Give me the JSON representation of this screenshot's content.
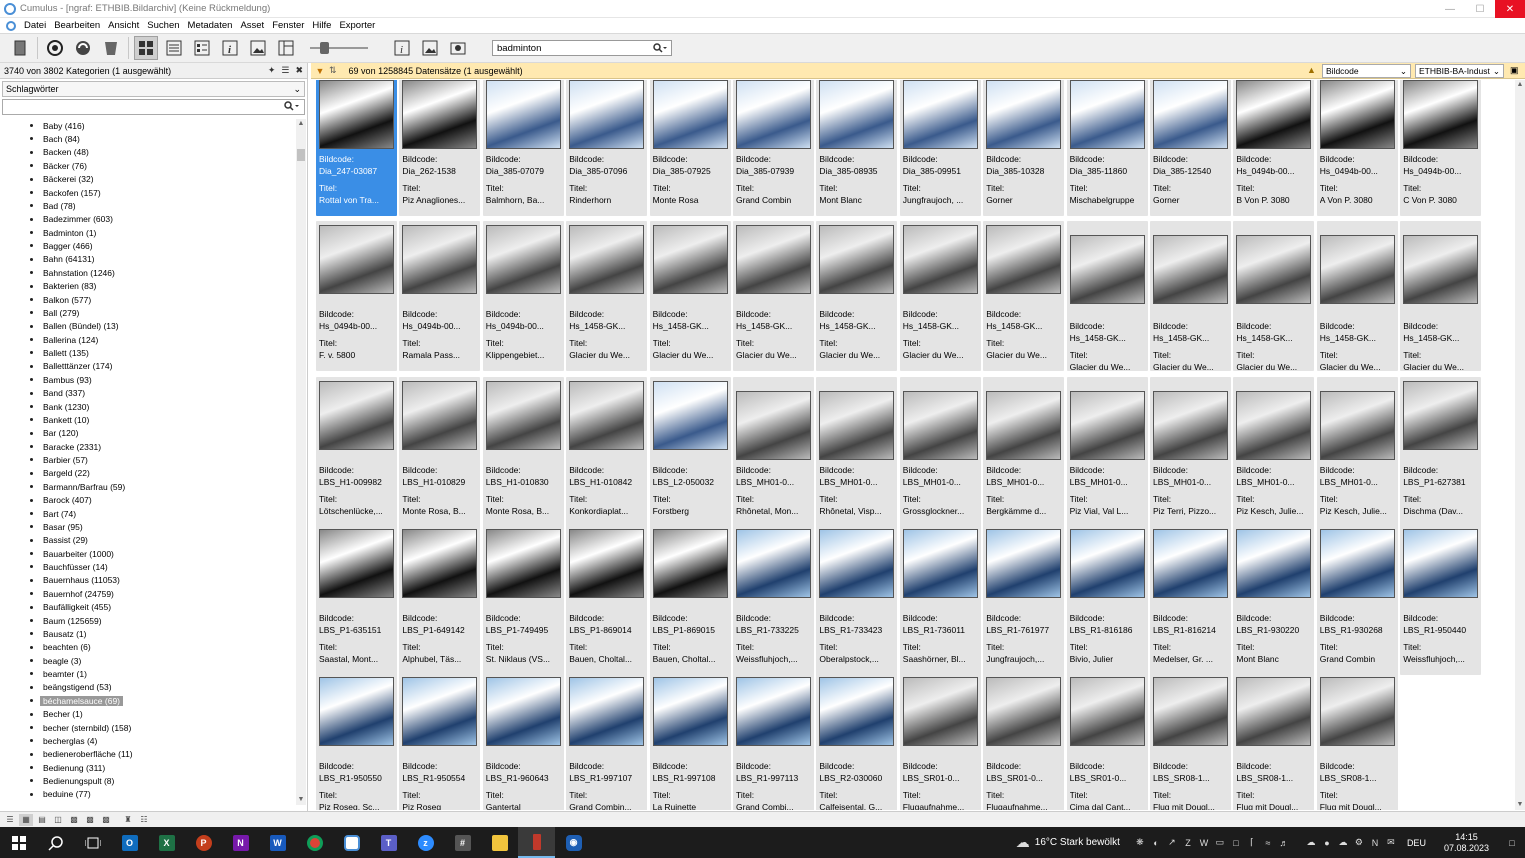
{
  "window": {
    "title": "Cumulus - [ngraf: ETHBIB.Bildarchiv] (Keine Rückmeldung)"
  },
  "menu": [
    "Datei",
    "Bearbeiten",
    "Ansicht",
    "Suchen",
    "Metadaten",
    "Asset",
    "Fenster",
    "Hilfe",
    "Exporter"
  ],
  "toolbar": {
    "search_value": "badminton"
  },
  "left": {
    "header": "3740 von 3802 Kategorien (1 ausgewählt)",
    "section": "Schlagwörter",
    "keywords": [
      "Baby (416)",
      "Bach (84)",
      "Backen (48)",
      "Bäcker (76)",
      "Bäckerei (32)",
      "Backofen (157)",
      "Bad (78)",
      "Badezimmer (603)",
      "Badminton (1)",
      "Bagger (466)",
      "Bahn (64131)",
      "Bahnstation (1246)",
      "Bakterien (83)",
      "Balkon (577)",
      "Ball (279)",
      "Ballen (Bündel) (13)",
      "Ballerina (124)",
      "Ballett (135)",
      "Balletttänzer (174)",
      "Bambus (93)",
      "Band (337)",
      "Bank (1230)",
      "Bankett (10)",
      "Bar (120)",
      "Baracke (2331)",
      "Barbier (57)",
      "Bargeld (22)",
      "Barmann/Barfrau (59)",
      "Barock (407)",
      "Bart (74)",
      "Basar (95)",
      "Bassist (29)",
      "Bauarbeiter (1000)",
      "Bauchfüsser (14)",
      "Bauernhaus (11053)",
      "Bauernhof (24759)",
      "Baufälligkeit (455)",
      "Baum (125659)",
      "Bausatz (1)",
      "beachten (6)",
      "beagle (3)",
      "beamter (1)",
      "beängstigend (53)",
      "béchamelsauce (69)",
      "Becher (1)",
      "becher (sternbild) (158)",
      "becherglas (4)",
      "bedieneroberfläche (11)",
      "Bedienung (311)",
      "Bedienungspult (8)",
      "beduine (77)"
    ],
    "selected_index": 43
  },
  "right": {
    "header": "69 von 1258845 Datensätze (1 ausgewählt)",
    "sort1": "Bildcode",
    "sort2": "ETHBIB-BA-Indust",
    "label_code": "Bildcode:",
    "label_title": "Titel:",
    "rows": [
      [
        [
          "Dia_247-03087",
          "Rottal von Tra..."
        ],
        [
          "Dia_262-1538",
          "Piz Anagliones..."
        ],
        [
          "Dia_385-07079",
          "Balmhorn, Ba..."
        ],
        [
          "Dia_385-07096",
          "Rinderhorn"
        ],
        [
          "Dia_385-07925",
          "Monte Rosa"
        ],
        [
          "Dia_385-07939",
          "Grand Combin"
        ],
        [
          "Dia_385-08935",
          "Mont Blanc"
        ],
        [
          "Dia_385-09951",
          "Jungfraujoch, ..."
        ],
        [
          "Dia_385-10328",
          "Gorner"
        ],
        [
          "Dia_385-11860",
          "Mischabelgruppe"
        ],
        [
          "Dia_385-12540",
          "Gorner"
        ],
        [
          "Hs_0494b-00...",
          "B Von P. 3080"
        ],
        [
          "Hs_0494b-00...",
          "A Von P. 3080"
        ],
        [
          "Hs_0494b-00...",
          "C Von P. 3080"
        ]
      ],
      [
        [
          "Hs_0494b-00...",
          "F. v. 5800"
        ],
        [
          "Hs_0494b-00...",
          "Ramala Pass..."
        ],
        [
          "Hs_0494b-00...",
          "Klippengebiet..."
        ],
        [
          "Hs_1458-GK...",
          "Glacier du We..."
        ],
        [
          "Hs_1458-GK...",
          "Glacier du We..."
        ],
        [
          "Hs_1458-GK...",
          "Glacier du We..."
        ],
        [
          "Hs_1458-GK...",
          "Glacier du We..."
        ],
        [
          "Hs_1458-GK...",
          "Glacier du We..."
        ],
        [
          "Hs_1458-GK...",
          "Glacier du We..."
        ],
        [
          "Hs_1458-GK...",
          "Glacier du We..."
        ],
        [
          "Hs_1458-GK...",
          "Glacier du We..."
        ],
        [
          "Hs_1458-GK...",
          "Glacier du We..."
        ],
        [
          "Hs_1458-GK...",
          "Glacier du We..."
        ],
        [
          "Hs_1458-GK...",
          "Glacier du We..."
        ]
      ],
      [
        [
          "LBS_H1-009982",
          "Lötschenlücke,..."
        ],
        [
          "LBS_H1-010829",
          "Monte Rosa, B..."
        ],
        [
          "LBS_H1-010830",
          "Monte Rosa, B..."
        ],
        [
          "LBS_H1-010842",
          "Konkordiaplat..."
        ],
        [
          "LBS_L2-050032",
          "Forstberg"
        ],
        [
          "LBS_MH01-0...",
          "Rhônetal, Mon..."
        ],
        [
          "LBS_MH01-0...",
          "Rhônetal, Visp..."
        ],
        [
          "LBS_MH01-0...",
          "Grossglockner..."
        ],
        [
          "LBS_MH01-0...",
          "Bergkämme d..."
        ],
        [
          "LBS_MH01-0...",
          "Piz Vial, Val L..."
        ],
        [
          "LBS_MH01-0...",
          "Piz Terri, Pizzo..."
        ],
        [
          "LBS_MH01-0...",
          "Piz Kesch, Julie..."
        ],
        [
          "LBS_MH01-0...",
          "Piz Kesch, Julie..."
        ],
        [
          "LBS_P1-627381",
          "Dischma (Dav..."
        ]
      ],
      [
        [
          "LBS_P1-635151",
          "Saastal, Mont..."
        ],
        [
          "LBS_P1-649142",
          "Alphubel, Täs..."
        ],
        [
          "LBS_P1-749495",
          "St. Niklaus (VS..."
        ],
        [
          "LBS_P1-869014",
          "Bauen, Choltal..."
        ],
        [
          "LBS_P1-869015",
          "Bauen, Choltal..."
        ],
        [
          "LBS_R1-733225",
          "Weissfluhjoch,..."
        ],
        [
          "LBS_R1-733423",
          "Oberalpstock,..."
        ],
        [
          "LBS_R1-736011",
          "Saashörner, Bl..."
        ],
        [
          "LBS_R1-761977",
          "Jungfraujoch,..."
        ],
        [
          "LBS_R1-816186",
          "Bivio, Julier"
        ],
        [
          "LBS_R1-816214",
          "Medelser, Gr. ..."
        ],
        [
          "LBS_R1-930220",
          "Mont Blanc"
        ],
        [
          "LBS_R1-930268",
          "Grand Combin"
        ],
        [
          "LBS_R1-950440",
          "Weissfluhjoch,..."
        ]
      ],
      [
        [
          "LBS_R1-950550",
          "Piz Roseg, Sc..."
        ],
        [
          "LBS_R1-950554",
          "Piz Roseg"
        ],
        [
          "LBS_R1-960643",
          "Gantertal"
        ],
        [
          "LBS_R1-997107",
          "Grand Combin..."
        ],
        [
          "LBS_R1-997108",
          "La Ruinette"
        ],
        [
          "LBS_R1-997113",
          "Grand Combi..."
        ],
        [
          "LBS_R2-030060",
          "Calfeisental, G..."
        ],
        [
          "LBS_SR01-0...",
          "Flugaufnahme..."
        ],
        [
          "LBS_SR01-0...",
          "Flugaufnahme..."
        ],
        [
          "LBS_SR01-0...",
          "Cima dal Cant..."
        ],
        [
          "LBS_SR08-1...",
          "Flug mit Dougl..."
        ],
        [
          "LBS_SR08-1...",
          "Flug mit Dougl..."
        ],
        [
          "LBS_SR08-1...",
          "Flug mit Dougl..."
        ]
      ]
    ]
  },
  "taskbar": {
    "weather": "16°C  Stark bewölkt",
    "lang": "DEU",
    "time": "14:15",
    "date": "07.08.2023"
  }
}
